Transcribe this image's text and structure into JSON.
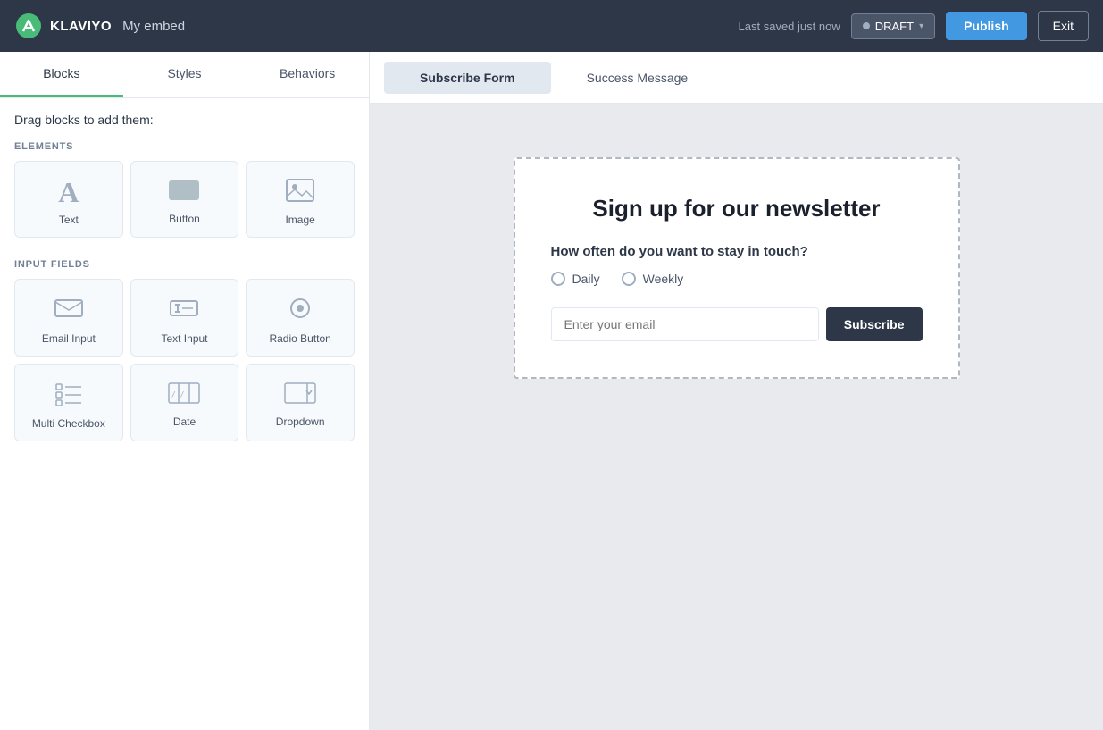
{
  "topnav": {
    "logo_text": "KLAVIYO",
    "embed_title": "My embed",
    "last_saved": "Last saved just now",
    "draft_label": "DRAFT",
    "publish_label": "Publish",
    "exit_label": "Exit"
  },
  "sidebar": {
    "tabs": [
      {
        "label": "Blocks",
        "active": true
      },
      {
        "label": "Styles",
        "active": false
      },
      {
        "label": "Behaviors",
        "active": false
      }
    ],
    "drag_hint": "Drag blocks to add them:",
    "elements_label": "ELEMENTS",
    "input_fields_label": "INPUT FIELDS",
    "elements": [
      {
        "label": "Text",
        "icon": "A"
      },
      {
        "label": "Button",
        "icon": "▮"
      },
      {
        "label": "Image",
        "icon": "🖼"
      }
    ],
    "input_fields": [
      {
        "label": "Email Input",
        "icon": "✉"
      },
      {
        "label": "Text Input",
        "icon": "T|"
      },
      {
        "label": "Radio Button",
        "icon": "◎"
      },
      {
        "label": "Multi Checkbox",
        "icon": "☰"
      },
      {
        "label": "Date",
        "icon": "/ /"
      },
      {
        "label": "Dropdown",
        "icon": "▭▾"
      }
    ]
  },
  "canvas": {
    "tabs": [
      {
        "label": "Subscribe Form",
        "active": true
      },
      {
        "label": "Success Message",
        "active": false
      }
    ],
    "form": {
      "title": "Sign up for our newsletter",
      "question": "How often do you want to stay in touch?",
      "options": [
        "Daily",
        "Weekly"
      ],
      "email_placeholder": "Enter your email",
      "subscribe_label": "Subscribe"
    }
  }
}
